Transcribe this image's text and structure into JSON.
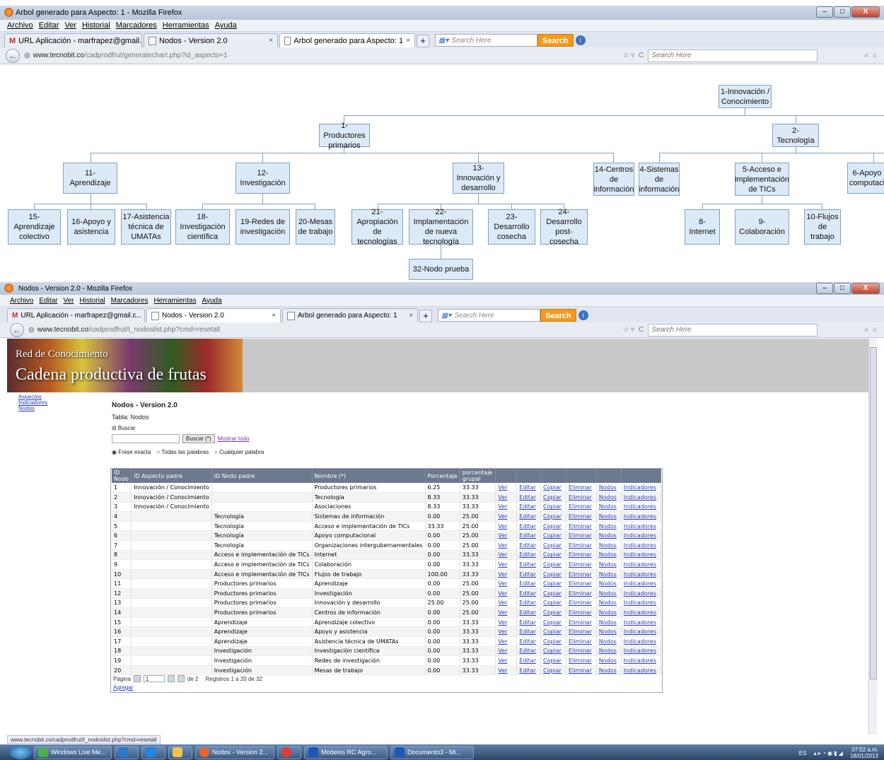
{
  "win1": {
    "title": "Arbol generado para Aspecto: 1 - Mozilla Firefox",
    "menu": [
      "Archivo",
      "Editar",
      "Ver",
      "Historial",
      "Marcadores",
      "Herramientas",
      "Ayuda"
    ],
    "tabs": [
      {
        "label": "URL Aplicación - marfrapez@gmail.c...",
        "type": "gmail"
      },
      {
        "label": "Nodos - Version 2.0",
        "type": "page"
      },
      {
        "label": "Arbol generado para Aspecto: 1",
        "type": "page",
        "active": true
      }
    ],
    "search_placeholder": "Search Here",
    "search_button": "Search",
    "url_host": "www.tecnobit.co",
    "url_path": "/cadprodfrut/generatechart.php?id_aspecto=1",
    "url_search_placeholder": "Search Here"
  },
  "tree": {
    "n1": "1-Innovación / Conocimiento",
    "n1a": "1-Productores primarios",
    "n2": "2-Tecnología",
    "n11": "11-Aprendizaje",
    "n12": "12-Investigación",
    "n13": "13-Innovación y desarrollo",
    "n14": "14-Centros de información",
    "n4": "4-Sistemas de información",
    "n5": "5-Acceso e implementación de TICs",
    "n6": "6-Apoyo computaci",
    "n15": "15-Aprendizaje colectivo",
    "n16": "16-Apoyo y asistencia",
    "n17": "17-Asistencia técnica de UMATAs",
    "n18": "18-Investigación científica",
    "n19": "19-Redes de investigación",
    "n20": "20-Mesas de trabajo",
    "n21": "21-Apropiación de tecnologías",
    "n22": "22-Implamentación de nueva tecnología",
    "n23": "23-Desarrollo cosecha",
    "n24": "24-Desarrollo post-cosecha",
    "n8": "8-Internet",
    "n9": "9-Colaboración",
    "n10": "10-Flujos de trabajo",
    "n32": "32-Nodo prueba"
  },
  "win2": {
    "title": "Nodos - Version 2.0 - Mozilla Firefox",
    "menu": [
      "Archivo",
      "Editar",
      "Ver",
      "Historial",
      "Marcadores",
      "Herramientas",
      "Ayuda"
    ],
    "tabs": [
      {
        "label": "URL Aplicación - marfrapez@gmail.c...",
        "type": "gmail"
      },
      {
        "label": "Nodos - Version 2.0",
        "type": "page",
        "active": true
      },
      {
        "label": "Arbol generado para Aspecto: 1",
        "type": "page"
      }
    ],
    "search_placeholder": "Search Here",
    "search_button": "Search",
    "url_host": "www.tecnobit.co",
    "url_path": "/cadprodfrut/t_nodoslist.php?cmd=resetall",
    "url_search_placeholder": "Search Here",
    "banner_line1": "Red de Conocimiento",
    "banner_line2": "Cadena productiva de frutas",
    "nav": [
      "Aspectos",
      "Indicadores",
      "Nodos"
    ],
    "page_title": "Nodos - Version 2.0",
    "table_label": "Tabla: Nodos",
    "search_toggle": "Buscar",
    "search_btn": "Buscar (*)",
    "show_all": "Mostrar todo",
    "radio": [
      "Frase exacta",
      "Todas las palabras",
      "Cualquier palabra"
    ],
    "columns": [
      "ID Nodo",
      "ID Aspecto padre",
      "ID Nodo padre",
      "Nombre (*)",
      "Porcentaje",
      "porcentaje grupal"
    ],
    "actions": [
      "Ver",
      "Editar",
      "Copiar",
      "Eliminar",
      "Nodos",
      "Indicadores"
    ],
    "rows": [
      [
        "1",
        "Innovación / Conocimiento",
        "",
        "Productores primarios",
        "6.25",
        "33.33"
      ],
      [
        "2",
        "Innovación / Conocimiento",
        "",
        "Tecnología",
        "8.33",
        "33.33"
      ],
      [
        "3",
        "Innovación / Conocimiento",
        "",
        "Asociaciones",
        "8.33",
        "33.33"
      ],
      [
        "4",
        "",
        "Tecnología",
        "Sistemas de información",
        "0.00",
        "25.00"
      ],
      [
        "5",
        "",
        "Tecnología",
        "Acceso e implementación de TICs",
        "33.33",
        "25.00"
      ],
      [
        "6",
        "",
        "Tecnología",
        "Apoyo computacional",
        "0.00",
        "25.00"
      ],
      [
        "7",
        "",
        "Tecnología",
        "Organizaciones intergubernamentales",
        "0.00",
        "25.00"
      ],
      [
        "8",
        "",
        "Acceso e implementación de TICs",
        "Internet",
        "0.00",
        "33.33"
      ],
      [
        "9",
        "",
        "Acceso e implementación de TICs",
        "Colaboración",
        "0.00",
        "33.33"
      ],
      [
        "10",
        "",
        "Acceso e implementación de TICs",
        "Flujos de trabajo",
        "100.00",
        "33.33"
      ],
      [
        "11",
        "",
        "Productores primarios",
        "Aprendizaje",
        "0.00",
        "25.00"
      ],
      [
        "12",
        "",
        "Productores primarios",
        "Investigación",
        "0.00",
        "25.00"
      ],
      [
        "13",
        "",
        "Productores primarios",
        "Innovación y desarrollo",
        "25.00",
        "25.00"
      ],
      [
        "14",
        "",
        "Productores primarios",
        "Centros de información",
        "0.00",
        "25.00"
      ],
      [
        "15",
        "",
        "Aprendizaje",
        "Aprendizaje colectivo",
        "0.00",
        "33.33"
      ],
      [
        "16",
        "",
        "Aprendizaje",
        "Apoyo y asistencia",
        "0.00",
        "33.33"
      ],
      [
        "17",
        "",
        "Aprendizaje",
        "Asistencia técnica de UMATAs",
        "0.00",
        "33.33"
      ],
      [
        "18",
        "",
        "Investigación",
        "Investigación científica",
        "0.00",
        "33.33"
      ],
      [
        "19",
        "",
        "Investigación",
        "Redes de investigación",
        "0.00",
        "33.33"
      ],
      [
        "20",
        "",
        "Investigación",
        "Mesas de trabajo",
        "0.00",
        "33.33"
      ]
    ],
    "pager_label": "Página",
    "pager_value": "1",
    "pager_of": "de 2",
    "pager_records": "Registros 1 a 20 de 32",
    "add_link": "Agregar",
    "status_url": "www.tecnobit.co/cadprodfrut/t_nodoslist.php?cmd=resetall"
  },
  "taskbar": {
    "items": [
      "Windows Live Me...",
      "Nodos - Version 2...",
      "Modelos RC Agro...",
      "Documento3 - Mi..."
    ],
    "lang": "ES",
    "time": "07:52 a.m.",
    "date": "18/01/2013"
  }
}
